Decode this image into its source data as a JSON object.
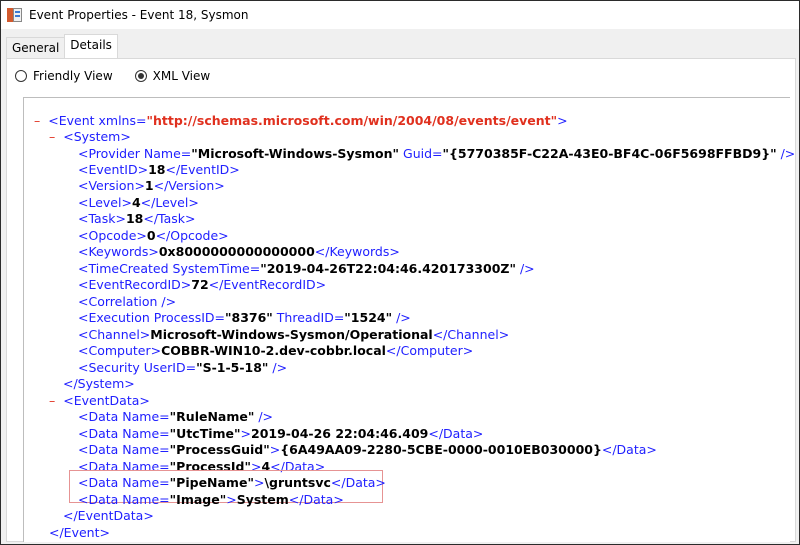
{
  "window": {
    "title": "Event Properties - Event 18, Sysmon"
  },
  "tabs": [
    {
      "label": "General"
    },
    {
      "label": "Details"
    }
  ],
  "view_options": [
    {
      "label": "Friendly View",
      "selected": false
    },
    {
      "label": "XML View",
      "selected": true
    }
  ],
  "xml": {
    "event_open": {
      "minus": "–",
      "tag": "<Event xmlns=",
      "url": "\"http://schemas.microsoft.com/win/2004/08/events/event\"",
      "tag_end": ">"
    },
    "system_open": {
      "minus": "–",
      "tag": "<System>"
    },
    "provider": {
      "tag1": "<Provider Name=",
      "v1": "\"Microsoft-Windows-Sysmon\"",
      "tag2": " Guid=",
      "v2": "\"{5770385F-C22A-43E0-BF4C-06F5698FFBD9}\"",
      "tag3": " />"
    },
    "eventid": {
      "open": "<EventID>",
      "value": "18",
      "close": "</EventID>"
    },
    "version": {
      "open": "<Version>",
      "value": "1",
      "close": "</Version>"
    },
    "level": {
      "open": "<Level>",
      "value": "4",
      "close": "</Level>"
    },
    "task": {
      "open": "<Task>",
      "value": "18",
      "close": "</Task>"
    },
    "opcode": {
      "open": "<Opcode>",
      "value": "0",
      "close": "</Opcode>"
    },
    "keywords": {
      "open": "<Keywords>",
      "value": "0x8000000000000000",
      "close": "</Keywords>"
    },
    "timecreated": {
      "tag1": "<TimeCreated SystemTime=",
      "v1": "\"2019-04-26T22:04:46.420173300Z\"",
      "tag2": " />"
    },
    "eventrecordid": {
      "open": "<EventRecordID>",
      "value": "72",
      "close": "</EventRecordID>"
    },
    "correlation": {
      "tag": "<Correlation />"
    },
    "execution": {
      "tag1": "<Execution ProcessID=",
      "v1": "\"8376\"",
      "tag2": " ThreadID=",
      "v2": "\"1524\"",
      "tag3": " />"
    },
    "channel": {
      "open": "<Channel>",
      "value": "Microsoft-Windows-Sysmon/Operational",
      "close": "</Channel>"
    },
    "computer": {
      "open": "<Computer>",
      "value": "COBBR-WIN10-2.dev-cobbr.local",
      "close": "</Computer>"
    },
    "security": {
      "tag1": "<Security UserID=",
      "v1": "\"S-1-5-18\"",
      "tag2": " />"
    },
    "system_close": {
      "tag": "</System>"
    },
    "eventdata_open": {
      "minus": "–",
      "tag": "<EventData>"
    },
    "data_rulename": {
      "tag1": "<Data Name=",
      "v1": "\"RuleName\"",
      "tag2": " />"
    },
    "data_utctime": {
      "tag1": "<Data Name=",
      "v1": "\"UtcTime\"",
      "tag2": ">",
      "value": "2019-04-26 22:04:46.409",
      "close": "</Data>"
    },
    "data_processguid": {
      "tag1": "<Data Name=",
      "v1": "\"ProcessGuid\"",
      "tag2": ">",
      "value": "{6A49AA09-2280-5CBE-0000-0010EB030000}",
      "close": "</Data>"
    },
    "data_processid": {
      "tag1": "<Data Name=",
      "v1": "\"ProcessId\"",
      "tag2": ">",
      "value": "4",
      "close": "</Data>"
    },
    "data_pipename": {
      "tag1": "<Data Name=",
      "v1": "\"PipeName\"",
      "tag2": ">",
      "value": "\\gruntsvc",
      "close": "</Data>"
    },
    "data_image": {
      "tag1": "<Data Name=",
      "v1": "\"Image\"",
      "tag2": ">",
      "value": "System",
      "close": "</Data>"
    },
    "eventdata_close": {
      "tag": "</EventData>"
    },
    "event_close": {
      "tag": "</Event>"
    }
  }
}
